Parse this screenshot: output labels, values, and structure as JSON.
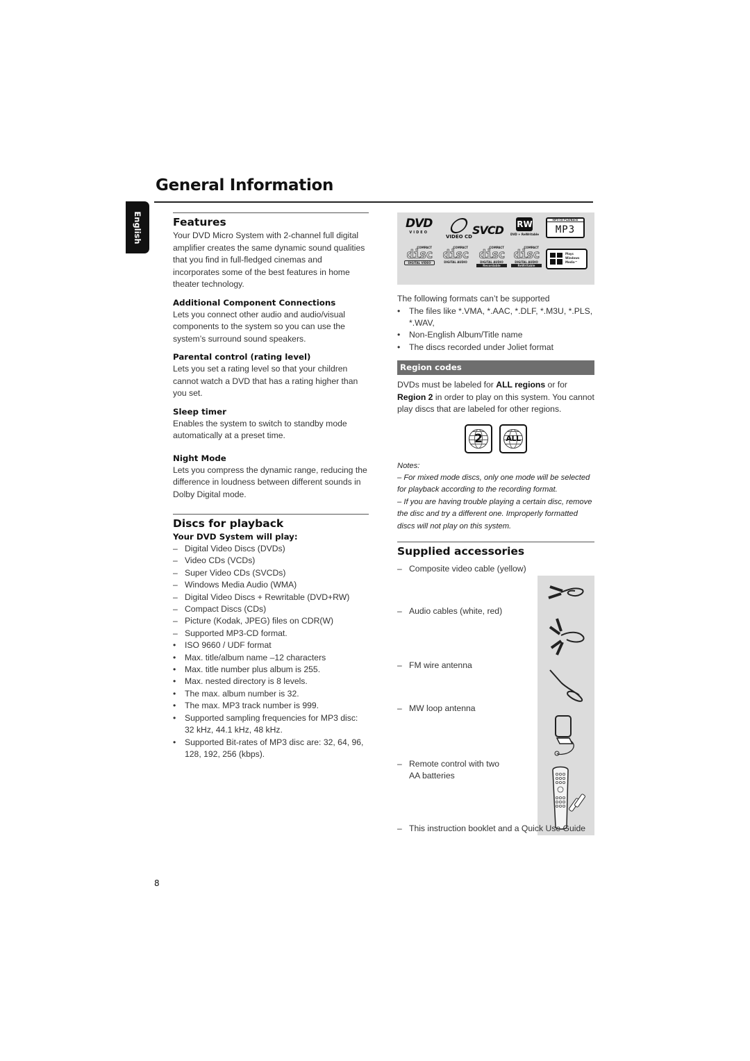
{
  "page": {
    "title": "General Information",
    "language_tab": "English",
    "page_number": "8"
  },
  "features": {
    "heading": "Features",
    "intro": "Your DVD Micro System with 2-channel full digital amplifier creates the same dynamic sound qualities that you find in full-fledged cinemas and incorporates some of the best features in home theater technology.",
    "items": [
      {
        "title": "Additional Component Connections",
        "text": "Lets you connect other audio and audio/visual components to the system so you can use the system’s surround sound speakers."
      },
      {
        "title": "Parental control (rating level)",
        "text": "Lets you set a rating level so that your children cannot watch a DVD that has a rating higher than you set."
      },
      {
        "title": "Sleep timer",
        "text": "Enables the system to switch to standby mode automatically at a preset time."
      },
      {
        "title": "Night Mode",
        "text": "Lets you compress the dynamic range, reducing the difference in loudness between different sounds in Dolby Digital mode."
      }
    ]
  },
  "discs": {
    "heading": "Discs for playback",
    "subheading": "Your DVD System will play:",
    "dash_items": [
      "Digital Video Discs (DVDs)",
      "Video CDs (VCDs)",
      "Super Video CDs (SVCDs)",
      "Windows Media Audio (WMA)",
      "Digital Video Discs + Rewritable (DVD+RW)",
      "Compact Discs (CDs)",
      "Picture (Kodak, JPEG) files on CDR(W)",
      "Supported MP3-CD format."
    ],
    "bullet_items": [
      "ISO 9660 / UDF format",
      "Max. title/album name –12 characters",
      "Max. title number plus album is 255.",
      "Max. nested directory is 8 levels.",
      "The max. album number is 32.",
      "The max. MP3 track number is 999.",
      "Supported sampling frequencies for MP3 disc:  32 kHz, 44.1 kHz, 48 kHz.",
      "Supported Bit-rates of MP3 disc are: 32, 64, 96, 128, 192, 256 (kbps)."
    ],
    "dash_marker": "–",
    "bullet_marker": "•"
  },
  "logos": {
    "dvd": "DVD",
    "dvd_sub": "VIDEO",
    "vcd": "VIDEO CD",
    "svcd": "SVCD",
    "rw": "RW",
    "rw_sub": "DVD + ReWritable",
    "mp3_top": "MP3-CD PLAYBACK",
    "mp3": "MP3",
    "compact": "COMPACT",
    "disc": "disc",
    "cd_labels": [
      "DIGITAL VIDEO",
      "DIGITAL AUDIO",
      "Recordable",
      "ReWritable"
    ],
    "cd_sub": "DIGITAL AUDIO",
    "windows_media": "Plays Windows Media™"
  },
  "unsupported": {
    "intro": "The following formats can’t be supported",
    "items": [
      "The files like *.VMA, *.AAC, *.DLF, *.M3U, *.PLS, *.WAV,",
      "Non-English Album/Title name",
      "The discs recorded under Joliet format"
    ]
  },
  "region": {
    "heading": "Region codes",
    "text_1": "DVDs must be labeled for ",
    "bold_1": "ALL regions",
    "text_2": " or for ",
    "bold_2": "Region 2",
    "text_3": " in order to play on this system. You cannot play discs that are labeled for other regions.",
    "icon_labels": [
      "2",
      "ALL"
    ],
    "bar_color": "#6e6e6e"
  },
  "notes": {
    "label": "Notes:",
    "items": [
      "–  For mixed mode discs, only one mode will be selected for playback according to the recording format.",
      "–  If you are having trouble playing a certain disc, remove the disc and try a different one. Improperly formatted discs will not play on this system."
    ]
  },
  "accessories": {
    "heading": "Supplied accessories",
    "marker": "–",
    "items": [
      "Composite video cable (yellow)",
      "Audio cables (white, red)",
      "FM wire antenna",
      "MW loop antenna",
      "Remote control with two AA batteries",
      "This instruction booklet and a Quick Use Guide"
    ]
  }
}
